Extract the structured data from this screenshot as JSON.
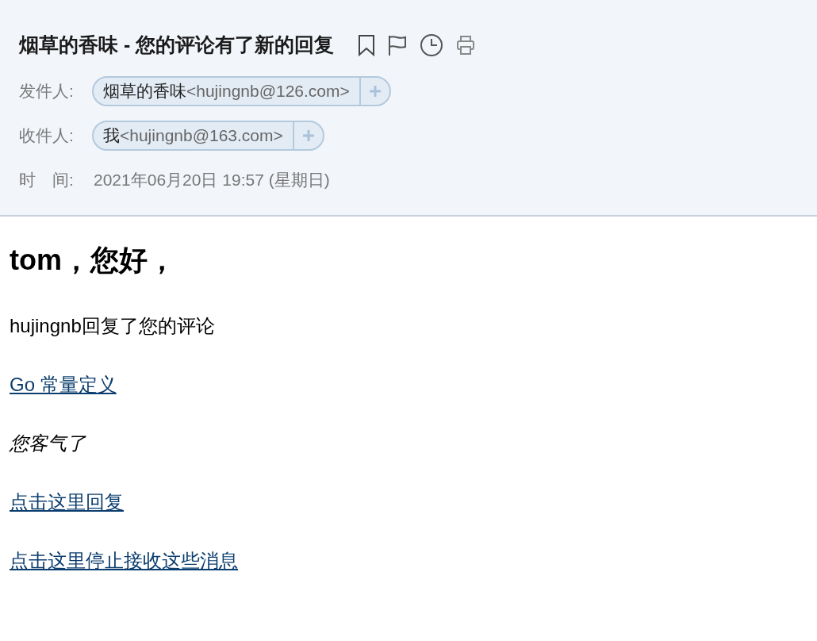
{
  "mail": {
    "subject": "烟草的香味 - 您的评论有了新的回复",
    "fields": [
      {
        "kind": "contact",
        "label": "发件人:",
        "name": "烟草的香味",
        "address": "<hujingnb@126.com>"
      },
      {
        "kind": "contact",
        "label": "收件人:",
        "name": "我",
        "address": "<hujingnb@163.com>"
      },
      {
        "kind": "text",
        "label": "时　间:",
        "value": "2021年06月20日 19:57 (星期日)"
      }
    ]
  },
  "body": [
    {
      "kind": "heading",
      "text": "tom，您好，"
    },
    {
      "kind": "text",
      "text": "hujingnb回复了您的评论"
    },
    {
      "kind": "link",
      "text": "Go 常量定义"
    },
    {
      "kind": "quote",
      "text": "您客气了"
    },
    {
      "kind": "link",
      "text": "点击这里回复"
    },
    {
      "kind": "link",
      "text": "点击这里停止接收这些消息"
    }
  ]
}
